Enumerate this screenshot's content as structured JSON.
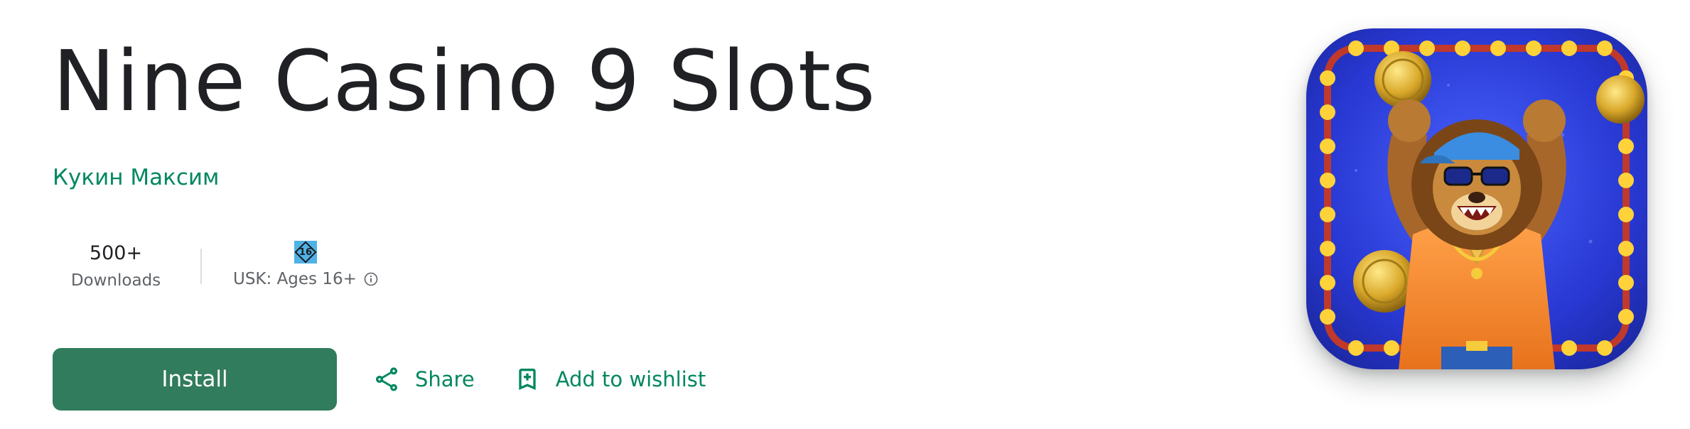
{
  "app": {
    "title": "Nine Casino 9 Slots",
    "developer": "Кукин Максим"
  },
  "stats": {
    "downloads": {
      "value": "500+",
      "label": "Downloads"
    },
    "rating": {
      "badge_text": "16",
      "label": "USK: Ages 16+",
      "info_icon": "info-icon"
    }
  },
  "actions": {
    "install_label": "Install",
    "share_label": "Share",
    "share_icon": "share-icon",
    "wishlist_label": "Add to wishlist",
    "wishlist_icon": "bookmark-add-icon"
  },
  "icon": {
    "name": "app-icon",
    "depicts": "cartoon lion with cap and sunglasses, gold coins, marquee lights"
  },
  "colors": {
    "accent": "#01875f",
    "install_button": "#317c5c",
    "icon_background": "#2a3bd6",
    "usk_badge": "#4fb1e6"
  }
}
